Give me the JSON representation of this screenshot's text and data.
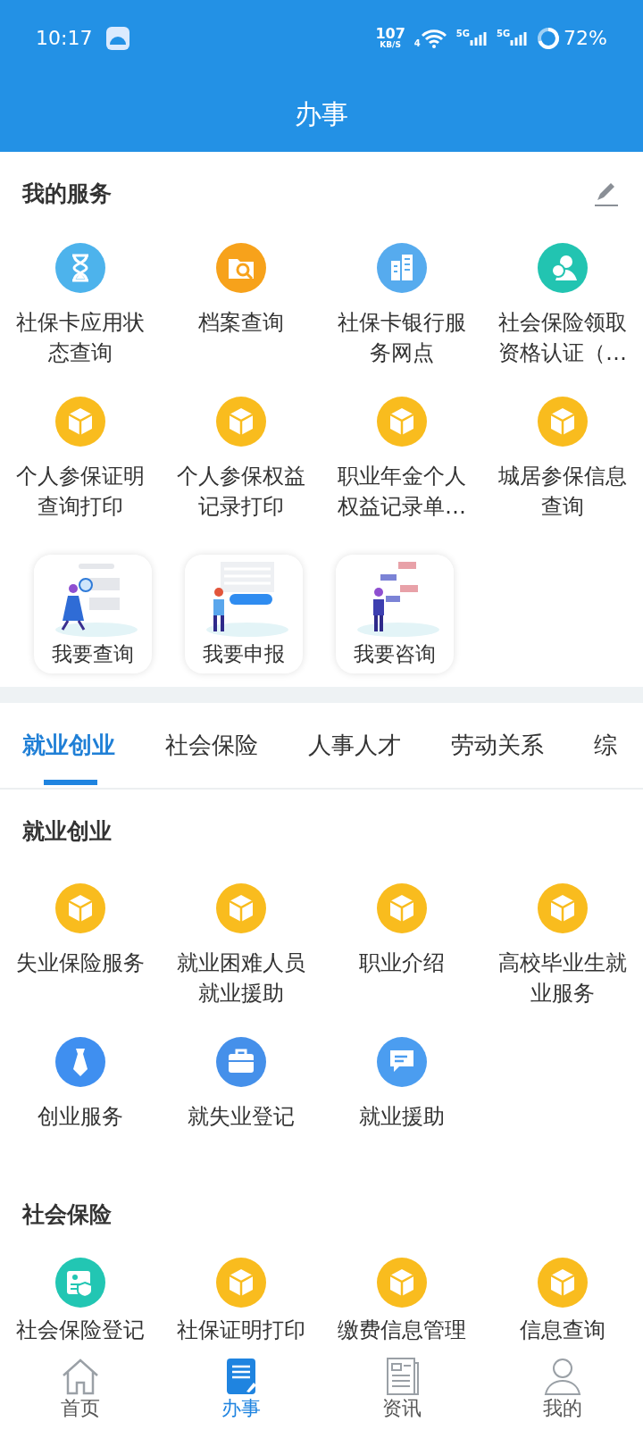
{
  "status_bar": {
    "time": "10:17",
    "speed_value": "107",
    "speed_unit": "KB/S",
    "wifi_label": "4",
    "sim_labels": [
      "5G",
      "5G"
    ],
    "battery": "72%"
  },
  "header": {
    "title": "办事"
  },
  "my_services": {
    "title": "我的服务",
    "items": [
      {
        "label": "社保卡应用状态查询",
        "kind": "hourglass"
      },
      {
        "label": "档案查询",
        "kind": "folder_search"
      },
      {
        "label": "社保卡银行服务网点",
        "kind": "buildings"
      },
      {
        "label": "社会保险领取资格认证（…",
        "kind": "person_coin"
      },
      {
        "label": "个人参保证明查询打印",
        "kind": "cube"
      },
      {
        "label": "个人参保权益记录打印",
        "kind": "cube"
      },
      {
        "label": "职业年金个人权益记录单…",
        "kind": "cube"
      },
      {
        "label": "城居参保信息查询",
        "kind": "cube"
      }
    ]
  },
  "quick_cards": [
    {
      "label": "我要查询",
      "kind": "query"
    },
    {
      "label": "我要申报",
      "kind": "declare"
    },
    {
      "label": "我要咨询",
      "kind": "consult"
    }
  ],
  "tabs": [
    {
      "label": "就业创业",
      "selected": true
    },
    {
      "label": "社会保险",
      "selected": false
    },
    {
      "label": "人事人才",
      "selected": false
    },
    {
      "label": "劳动关系",
      "selected": false
    },
    {
      "label": "综",
      "selected": false
    }
  ],
  "sections": [
    {
      "title": "就业创业",
      "items": [
        {
          "label": "失业保险服务",
          "kind": "cube"
        },
        {
          "label": "就业困难人员就业援助",
          "kind": "cube"
        },
        {
          "label": "职业介绍",
          "kind": "cube"
        },
        {
          "label": "高校毕业生就业服务",
          "kind": "cube"
        },
        {
          "label": "创业服务",
          "kind": "tie"
        },
        {
          "label": "就失业登记",
          "kind": "briefcase"
        },
        {
          "label": "就业援助",
          "kind": "chat_edit"
        }
      ]
    },
    {
      "title": "社会保险",
      "items": [
        {
          "label": "社会保险登记",
          "kind": "id_card"
        },
        {
          "label": "社保证明打印",
          "kind": "cube"
        },
        {
          "label": "缴费信息管理",
          "kind": "cube"
        },
        {
          "label": "信息查询",
          "kind": "cube"
        }
      ]
    }
  ],
  "bottom_nav": [
    {
      "label": "首页",
      "kind": "home",
      "selected": false
    },
    {
      "label": "办事",
      "kind": "document",
      "selected": true
    },
    {
      "label": "资讯",
      "kind": "news",
      "selected": false
    },
    {
      "label": "我的",
      "kind": "person",
      "selected": false
    }
  ]
}
